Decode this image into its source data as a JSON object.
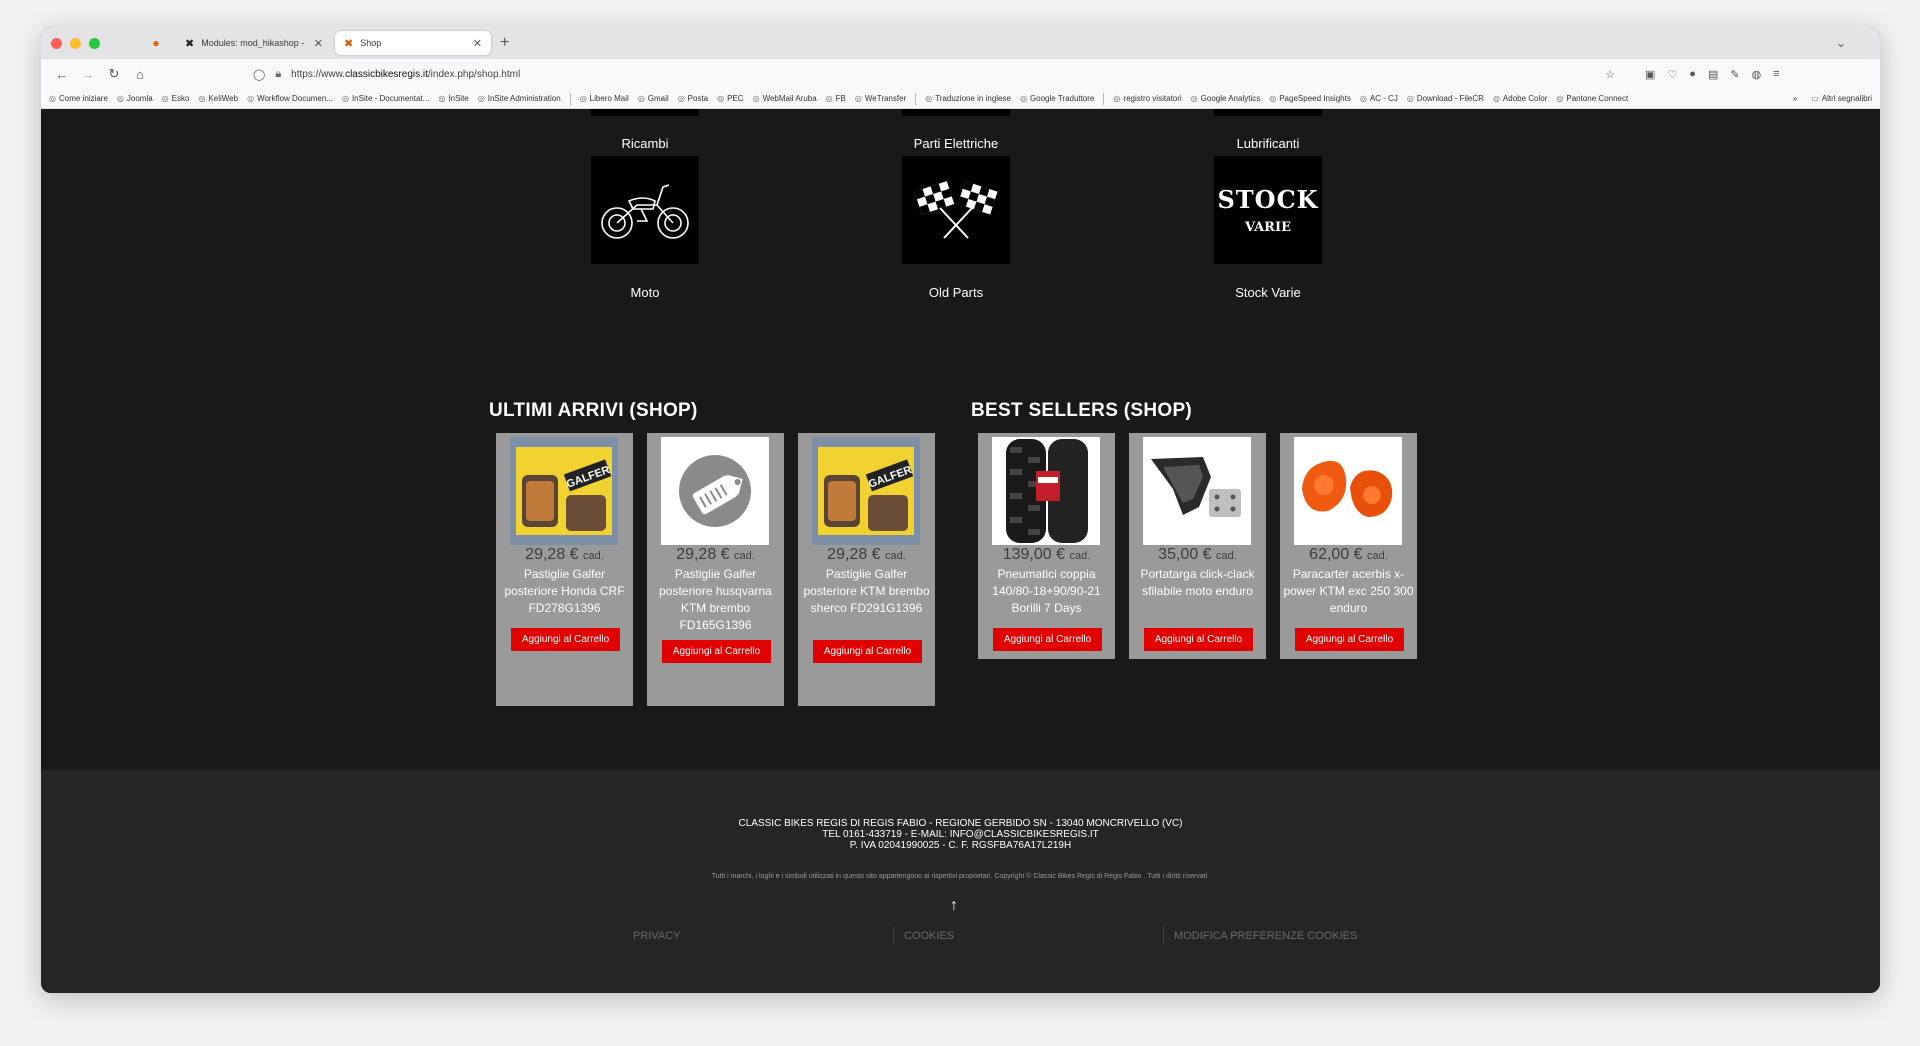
{
  "browser": {
    "tabs": [
      {
        "title": ""
      },
      {
        "title": "Modules: mod_hikashop - Classic"
      },
      {
        "title": "Shop"
      }
    ],
    "url_prefix": "https://www.",
    "url_domain": "classicbikesregis.it",
    "url_path": "/index.php/shop.html",
    "bookmarks": [
      "Come iniziare",
      "Joomla",
      "Esko",
      "KeliWeb",
      "Workflow Documen...",
      "InSite - Documentat...",
      "InSite",
      "InSite Administration",
      "Libero Mail",
      "Gmail",
      "Posta",
      "PEC",
      "WebMail Aruba",
      "FB",
      "WeTransfer",
      "Traduzione in inglese",
      "Google Traduttore",
      "registro visitatori",
      "Google Analytics",
      "PageSpeed Insights",
      "AC - CJ",
      "Download - FileCR",
      "Adobe Color",
      "Pantone Connect"
    ],
    "other_bookmarks": "Altri segnalibri"
  },
  "categories": {
    "row1": [
      "Ricambi",
      "Parti Elettriche",
      "Lubrificanti"
    ],
    "row2": [
      "Moto",
      "Old Parts",
      "Stock Varie"
    ],
    "stock_line1": "STOCK",
    "stock_line2": "VARIE"
  },
  "sections": {
    "latest_title": "ULTIMI ARRIVI (SHOP)",
    "best_title": "BEST SELLERS (SHOP)"
  },
  "latest": [
    {
      "price": "29,28 €",
      "unit": "cad.",
      "name": "Pastiglie Galfer posteriore Honda CRF FD278G1396",
      "button": "Aggiungi al Carrello"
    },
    {
      "price": "29,28 €",
      "unit": "cad.",
      "name": "Pastiglie Galfer posteriore husqvarna KTM brembo FD165G1396",
      "button": "Aggiungi al Carrello"
    },
    {
      "price": "29,28 €",
      "unit": "cad.",
      "name": "Pastiglie Galfer posteriore KTM brembo sherco FD291G1396",
      "button": "Aggiungi al Carrello"
    }
  ],
  "best": [
    {
      "price": "139,00 €",
      "unit": "cad.",
      "name": "Pneumatici coppia 140/80-18+90/90-21 Borilli 7 Days",
      "button": "Aggiungi al Carrello"
    },
    {
      "price": "35,00 €",
      "unit": "cad.",
      "name": "Portatarga click-clack sfilabile moto enduro",
      "button": "Aggiungi al Carrello"
    },
    {
      "price": "62,00 €",
      "unit": "cad.",
      "name": "Paracarter acerbis x-power KTM exc 250 300 enduro",
      "button": "Aggiungi al Carrello"
    }
  ],
  "product_brand": "GALFER",
  "footer": {
    "line1": "CLASSIC BIKES REGIS DI REGIS FABIO - REGIONE GERBIDO SN - 13040 MONCRIVELLO (VC)",
    "line2": "TEL 0161-433719 - E-MAIL: INFO@CLASSICBIKESREGIS.IT",
    "line3": "P. IVA 02041990025  -  C. F. RGSFBA76A17L219H",
    "copyright": "Tutti i marchi, i loghi e i simboli utilizzati in questo sito appartengono ai rispettivi proprietari. Copyright © Classic Bikes Regis di Regis Fabio . Tutti i diritti riservati.",
    "links": [
      "PRIVACY",
      "COOKIES",
      "MODIFICA PREFERENZE COOKIES"
    ]
  },
  "colors": {
    "button": "#e00000",
    "card": "#9a9a9a",
    "page_bg": "#191919",
    "footer_bg": "#252525"
  }
}
